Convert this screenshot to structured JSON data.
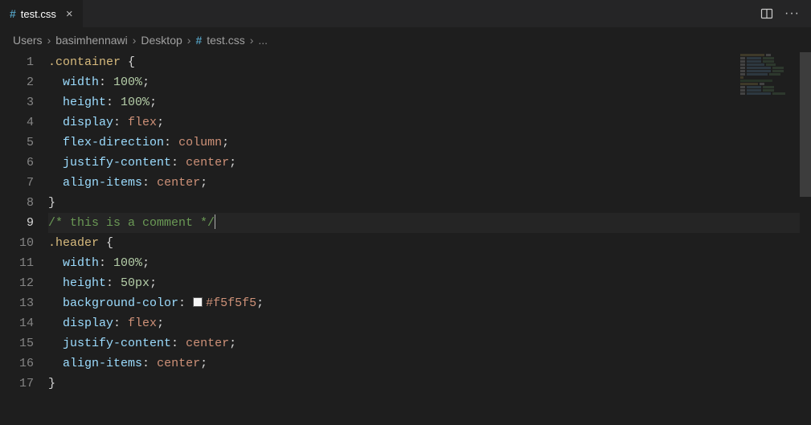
{
  "tab": {
    "icon": "#",
    "filename": "test.css"
  },
  "breadcrumb": {
    "segments": [
      "Users",
      "basimhennawi",
      "Desktop"
    ],
    "file_icon": "#",
    "file": "test.css",
    "trailing": "..."
  },
  "active_line": 9,
  "code": {
    "lines": [
      {
        "n": 1,
        "indent": 0,
        "tokens": [
          {
            "t": ".container ",
            "c": "tok-sel"
          },
          {
            "t": "{",
            "c": "tok-brace"
          }
        ]
      },
      {
        "n": 2,
        "indent": 1,
        "tokens": [
          {
            "t": "width",
            "c": "tok-prop"
          },
          {
            "t": ": ",
            "c": "tok-punc"
          },
          {
            "t": "100%",
            "c": "tok-num"
          },
          {
            "t": ";",
            "c": "tok-punc"
          }
        ]
      },
      {
        "n": 3,
        "indent": 1,
        "tokens": [
          {
            "t": "height",
            "c": "tok-prop"
          },
          {
            "t": ": ",
            "c": "tok-punc"
          },
          {
            "t": "100%",
            "c": "tok-num"
          },
          {
            "t": ";",
            "c": "tok-punc"
          }
        ]
      },
      {
        "n": 4,
        "indent": 1,
        "tokens": [
          {
            "t": "display",
            "c": "tok-prop"
          },
          {
            "t": ": ",
            "c": "tok-punc"
          },
          {
            "t": "flex",
            "c": "tok-val"
          },
          {
            "t": ";",
            "c": "tok-punc"
          }
        ]
      },
      {
        "n": 5,
        "indent": 1,
        "tokens": [
          {
            "t": "flex-direction",
            "c": "tok-prop"
          },
          {
            "t": ": ",
            "c": "tok-punc"
          },
          {
            "t": "column",
            "c": "tok-val"
          },
          {
            "t": ";",
            "c": "tok-punc"
          }
        ]
      },
      {
        "n": 6,
        "indent": 1,
        "tokens": [
          {
            "t": "justify-content",
            "c": "tok-prop"
          },
          {
            "t": ": ",
            "c": "tok-punc"
          },
          {
            "t": "center",
            "c": "tok-val"
          },
          {
            "t": ";",
            "c": "tok-punc"
          }
        ]
      },
      {
        "n": 7,
        "indent": 1,
        "tokens": [
          {
            "t": "align-items",
            "c": "tok-prop"
          },
          {
            "t": ": ",
            "c": "tok-punc"
          },
          {
            "t": "center",
            "c": "tok-val"
          },
          {
            "t": ";",
            "c": "tok-punc"
          }
        ]
      },
      {
        "n": 8,
        "indent": 0,
        "tokens": [
          {
            "t": "}",
            "c": "tok-brace"
          }
        ]
      },
      {
        "n": 9,
        "indent": 0,
        "cursor_after": true,
        "tokens": [
          {
            "t": "/* this is a comment */",
            "c": "tok-comm"
          }
        ]
      },
      {
        "n": 10,
        "indent": 0,
        "tokens": [
          {
            "t": ".header ",
            "c": "tok-sel"
          },
          {
            "t": "{",
            "c": "tok-brace"
          }
        ]
      },
      {
        "n": 11,
        "indent": 1,
        "tokens": [
          {
            "t": "width",
            "c": "tok-prop"
          },
          {
            "t": ": ",
            "c": "tok-punc"
          },
          {
            "t": "100%",
            "c": "tok-num"
          },
          {
            "t": ";",
            "c": "tok-punc"
          }
        ]
      },
      {
        "n": 12,
        "indent": 1,
        "tokens": [
          {
            "t": "height",
            "c": "tok-prop"
          },
          {
            "t": ": ",
            "c": "tok-punc"
          },
          {
            "t": "50px",
            "c": "tok-num"
          },
          {
            "t": ";",
            "c": "tok-punc"
          }
        ]
      },
      {
        "n": 13,
        "indent": 1,
        "swatch": "#f5f5f5",
        "tokens": [
          {
            "t": "background-color",
            "c": "tok-prop"
          },
          {
            "t": ": ",
            "c": "tok-punc"
          },
          {
            "t": "#f5f5f5",
            "c": "tok-val",
            "swatch": true
          },
          {
            "t": ";",
            "c": "tok-punc"
          }
        ]
      },
      {
        "n": 14,
        "indent": 1,
        "tokens": [
          {
            "t": "display",
            "c": "tok-prop"
          },
          {
            "t": ": ",
            "c": "tok-punc"
          },
          {
            "t": "flex",
            "c": "tok-val"
          },
          {
            "t": ";",
            "c": "tok-punc"
          }
        ]
      },
      {
        "n": 15,
        "indent": 1,
        "tokens": [
          {
            "t": "justify-content",
            "c": "tok-prop"
          },
          {
            "t": ": ",
            "c": "tok-punc"
          },
          {
            "t": "center",
            "c": "tok-val"
          },
          {
            "t": ";",
            "c": "tok-punc"
          }
        ]
      },
      {
        "n": 16,
        "indent": 1,
        "tokens": [
          {
            "t": "align-items",
            "c": "tok-prop"
          },
          {
            "t": ": ",
            "c": "tok-punc"
          },
          {
            "t": "center",
            "c": "tok-val"
          },
          {
            "t": ";",
            "c": "tok-punc"
          }
        ]
      },
      {
        "n": 17,
        "indent": 0,
        "tokens": [
          {
            "t": "}",
            "c": "tok-brace"
          }
        ]
      }
    ]
  }
}
